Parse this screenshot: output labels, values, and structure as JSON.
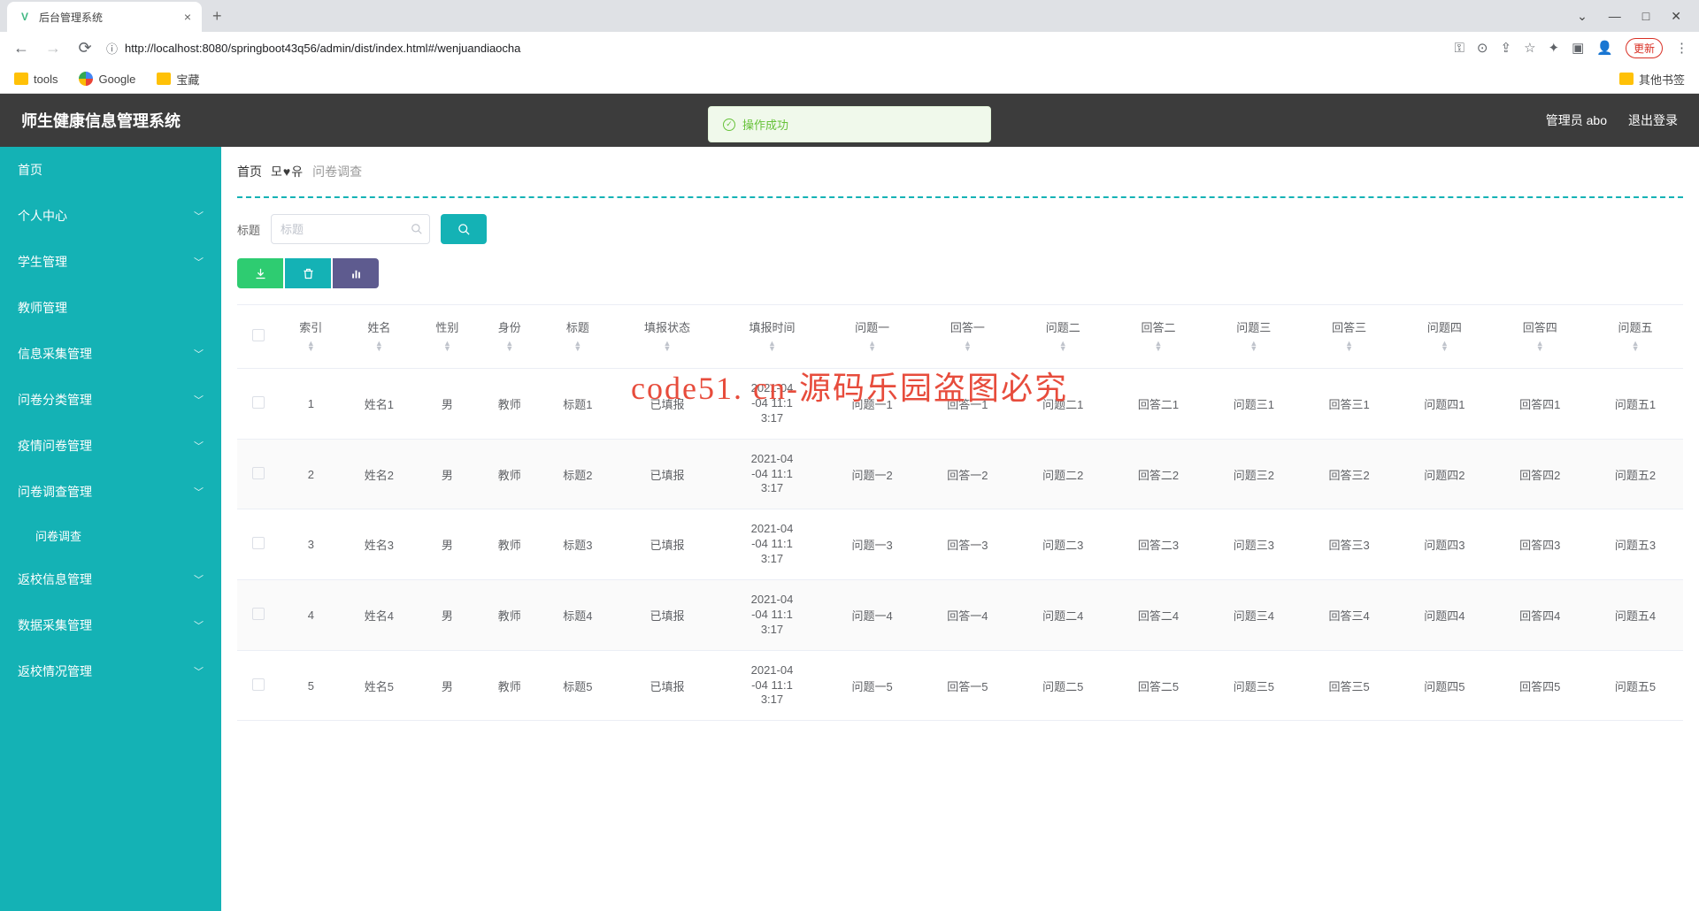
{
  "browser": {
    "tab_title": "后台管理系统",
    "url": "http://localhost:8080/springboot43q56/admin/dist/index.html#/wenjuandiaocha",
    "update_btn": "更新",
    "bookmarks": [
      "tools",
      "Google",
      "宝藏"
    ],
    "other_bookmarks": "其他书签"
  },
  "header": {
    "app_title": "师生健康信息管理系统",
    "user_label": "管理员 abo",
    "logout": "退出登录",
    "toast": "操作成功"
  },
  "sidebar": {
    "items": [
      {
        "label": "首页",
        "expandable": false
      },
      {
        "label": "个人中心",
        "expandable": true
      },
      {
        "label": "学生管理",
        "expandable": true
      },
      {
        "label": "教师管理",
        "expandable": false
      },
      {
        "label": "信息采集管理",
        "expandable": true
      },
      {
        "label": "问卷分类管理",
        "expandable": true
      },
      {
        "label": "疫情问卷管理",
        "expandable": true
      },
      {
        "label": "问卷调查管理",
        "expandable": true,
        "children": [
          {
            "label": "问卷调查"
          }
        ]
      },
      {
        "label": "返校信息管理",
        "expandable": true
      },
      {
        "label": "数据采集管理",
        "expandable": true
      },
      {
        "label": "返校情况管理",
        "expandable": true
      }
    ]
  },
  "breadcrumb": {
    "home": "首页",
    "sep": "모♥유",
    "current": "问卷调查"
  },
  "search": {
    "label": "标题",
    "placeholder": "标题"
  },
  "table": {
    "headers": [
      "",
      "索引",
      "姓名",
      "性别",
      "身份",
      "标题",
      "填报状态",
      "填报时间",
      "问题一",
      "回答一",
      "问题二",
      "回答二",
      "问题三",
      "回答三",
      "问题四",
      "回答四",
      "问题五"
    ],
    "rows": [
      {
        "idx": "1",
        "name": "姓名1",
        "gender": "男",
        "role": "教师",
        "title": "标题1",
        "status": "已填报",
        "time": "2021-04-04 11:13:17",
        "q1": "问题一1",
        "a1": "回答一1",
        "q2": "问题二1",
        "a2": "回答二1",
        "q3": "问题三1",
        "a3": "回答三1",
        "q4": "问题四1",
        "a4": "回答四1",
        "q5": "问题五1"
      },
      {
        "idx": "2",
        "name": "姓名2",
        "gender": "男",
        "role": "教师",
        "title": "标题2",
        "status": "已填报",
        "time": "2021-04-04 11:13:17",
        "q1": "问题一2",
        "a1": "回答一2",
        "q2": "问题二2",
        "a2": "回答二2",
        "q3": "问题三2",
        "a3": "回答三2",
        "q4": "问题四2",
        "a4": "回答四2",
        "q5": "问题五2"
      },
      {
        "idx": "3",
        "name": "姓名3",
        "gender": "男",
        "role": "教师",
        "title": "标题3",
        "status": "已填报",
        "time": "2021-04-04 11:13:17",
        "q1": "问题一3",
        "a1": "回答一3",
        "q2": "问题二3",
        "a2": "回答二3",
        "q3": "问题三3",
        "a3": "回答三3",
        "q4": "问题四3",
        "a4": "回答四3",
        "q5": "问题五3"
      },
      {
        "idx": "4",
        "name": "姓名4",
        "gender": "男",
        "role": "教师",
        "title": "标题4",
        "status": "已填报",
        "time": "2021-04-04 11:13:17",
        "q1": "问题一4",
        "a1": "回答一4",
        "q2": "问题二4",
        "a2": "回答二4",
        "q3": "问题三4",
        "a3": "回答三4",
        "q4": "问题四4",
        "a4": "回答四4",
        "q5": "问题五4"
      },
      {
        "idx": "5",
        "name": "姓名5",
        "gender": "男",
        "role": "教师",
        "title": "标题5",
        "status": "已填报",
        "time": "2021-04-04 11:13:17",
        "q1": "问题一5",
        "a1": "回答一5",
        "q2": "问题二5",
        "a2": "回答二5",
        "q3": "问题三5",
        "a3": "回答三5",
        "q4": "问题四5",
        "a4": "回答四5",
        "q5": "问题五5"
      }
    ]
  },
  "watermark": "code51. cn-源码乐园盗图必究"
}
